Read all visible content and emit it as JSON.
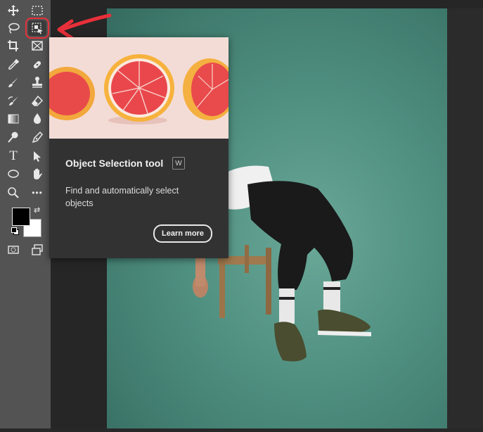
{
  "app": {
    "toolbar": {
      "tools": [
        {
          "id": "move-tool",
          "icon": "move-icon"
        },
        {
          "id": "marquee-tool",
          "icon": "rect-marquee-icon"
        },
        {
          "id": "lasso-tool",
          "icon": "lasso-icon"
        },
        {
          "id": "object-selection-tool",
          "icon": "object-selection-icon",
          "selected": true
        },
        {
          "id": "crop-tool",
          "icon": "crop-icon"
        },
        {
          "id": "frame-tool",
          "icon": "frame-icon"
        },
        {
          "id": "eyedropper-tool",
          "icon": "eyedropper-icon"
        },
        {
          "id": "healing-tool",
          "icon": "bandage-icon"
        },
        {
          "id": "brush-tool",
          "icon": "brush-icon"
        },
        {
          "id": "stamp-tool",
          "icon": "stamp-icon"
        },
        {
          "id": "history-brush-tool",
          "icon": "history-brush-icon"
        },
        {
          "id": "eraser-tool",
          "icon": "eraser-icon"
        },
        {
          "id": "gradient-tool",
          "icon": "gradient-icon"
        },
        {
          "id": "blur-tool",
          "icon": "drop-icon"
        },
        {
          "id": "dodge-tool",
          "icon": "dodge-icon"
        },
        {
          "id": "pen-tool",
          "icon": "pen-icon"
        },
        {
          "id": "type-tool",
          "label": "T",
          "icon": "type-icon"
        },
        {
          "id": "path-selection-tool",
          "icon": "arrow-pointer-icon"
        },
        {
          "id": "ellipse-tool",
          "icon": "ellipse-icon"
        },
        {
          "id": "hand-tool",
          "icon": "hand-icon"
        },
        {
          "id": "zoom-tool",
          "icon": "zoom-icon"
        },
        {
          "id": "more-tools",
          "label": "•••",
          "icon": "ellipsis-icon"
        }
      ],
      "foreground_color": "#000000",
      "background_color": "#ffffff"
    },
    "tooltip": {
      "title": "Object Selection tool",
      "shortcut": "W",
      "description": "Find and automatically select objects",
      "learn_more": "Learn more"
    },
    "colors": {
      "toolbar_bg": "#535353",
      "canvas_bg": "#4f8f80",
      "tooltip_bg": "#323232",
      "highlight": "#e8303a"
    }
  }
}
